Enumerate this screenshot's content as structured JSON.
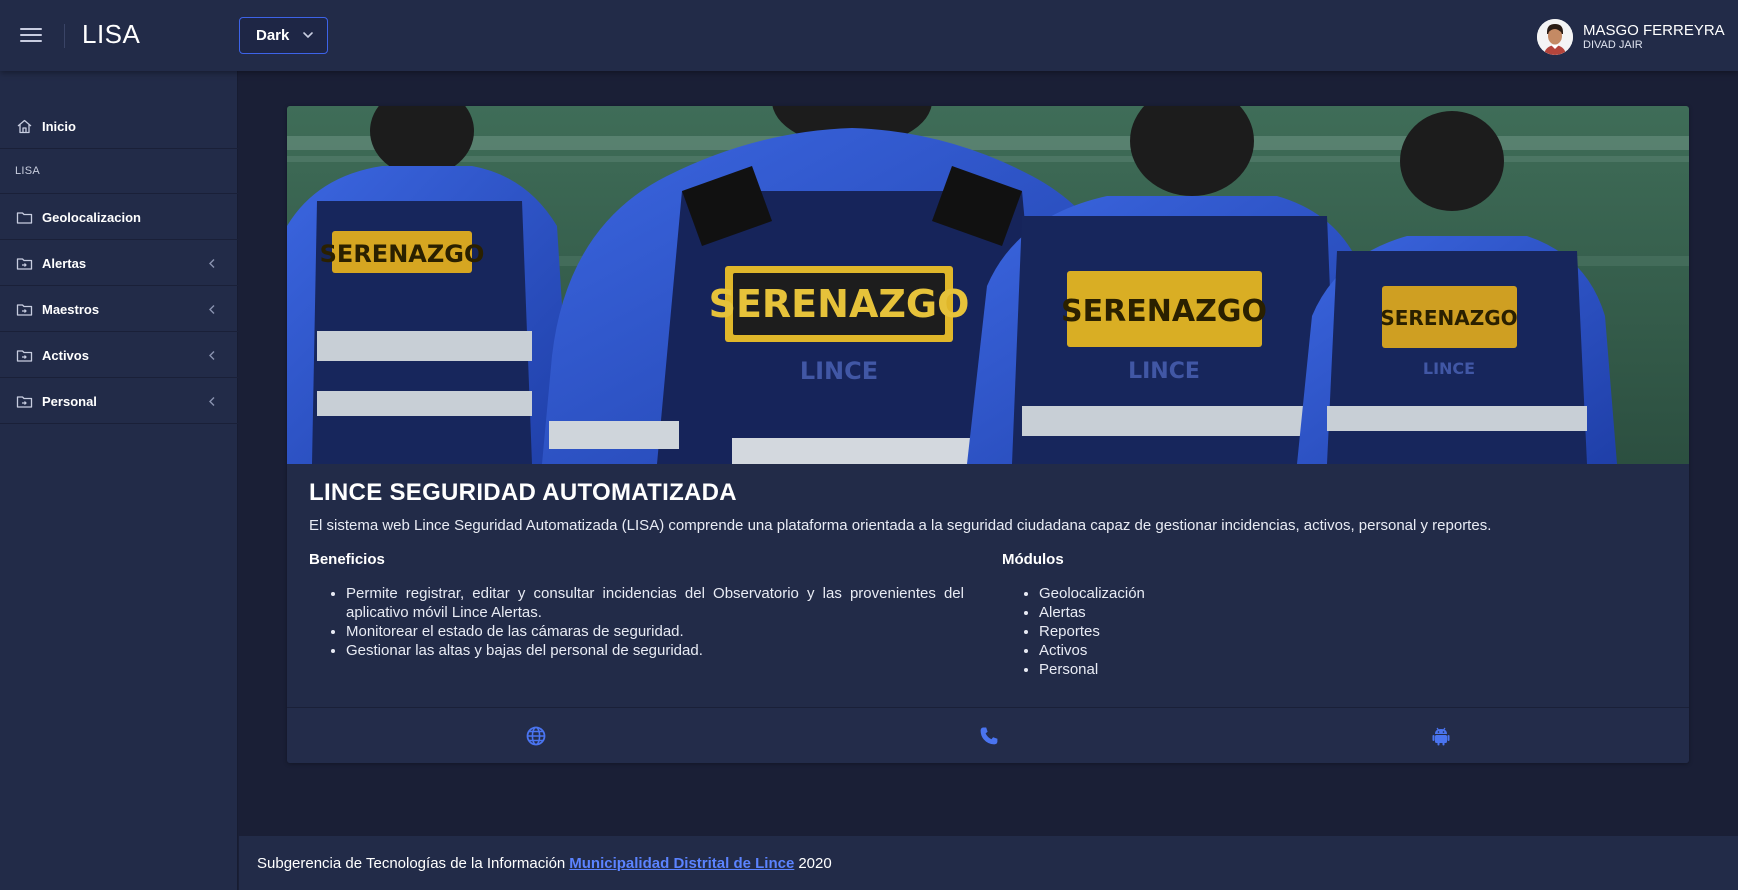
{
  "header": {
    "title": "LISA",
    "theme_select": {
      "value": "Dark"
    },
    "user": {
      "name": "MASGO FERREYRA",
      "subtitle": "DIVAD JAIR"
    }
  },
  "sidebar": {
    "items": [
      {
        "label": "Inicio",
        "icon": "home-icon"
      },
      {
        "section": "LISA"
      },
      {
        "label": "Geolocalizacion",
        "icon": "folder-icon"
      },
      {
        "label": "Alertas",
        "icon": "folder-plus-icon",
        "has_submenu": true
      },
      {
        "label": "Maestros",
        "icon": "folder-plus-icon",
        "has_submenu": true
      },
      {
        "label": "Activos",
        "icon": "folder-plus-icon",
        "has_submenu": true
      },
      {
        "label": "Personal",
        "icon": "folder-plus-icon",
        "has_submenu": true
      }
    ]
  },
  "card": {
    "hero_image": {
      "vest_text": [
        "SERENAZGO",
        "SERENAZGO",
        "SERENAZGO",
        "SERENAZGO"
      ],
      "sub_text": [
        "LINCE",
        "LINCE",
        "LINCE"
      ]
    },
    "title": "LINCE SEGURIDAD AUTOMATIZADA",
    "description": "El sistema web Lince Seguridad Automatizada (LISA) comprende una plataforma orientada a la seguridad ciudadana capaz de gestionar incidencias, activos, personal y reportes.",
    "benefits": {
      "heading": "Beneficios",
      "items": [
        "Permite registrar, editar y consultar incidencias del Observatorio y las provenientes del aplicativo móvil Lince Alertas.",
        "Monitorear el estado de las cámaras de seguridad.",
        "Gestionar las altas y bajas del personal de seguridad."
      ]
    },
    "modules": {
      "heading": "Módulos",
      "items": [
        "Geolocalización",
        "Alertas",
        "Reportes",
        "Activos",
        "Personal"
      ]
    },
    "footer_icons": [
      "globe-icon",
      "phone-icon",
      "android-icon"
    ]
  },
  "page_footer": {
    "text_before": "Subgerencia de Tecnologías de la Información",
    "link": "Municipalidad Distrital de Lince",
    "text_after": "2020"
  },
  "colors": {
    "background": "#1a1f36",
    "panel": "#222b48",
    "accent": "#3d63e8",
    "link": "#5b83ff"
  }
}
